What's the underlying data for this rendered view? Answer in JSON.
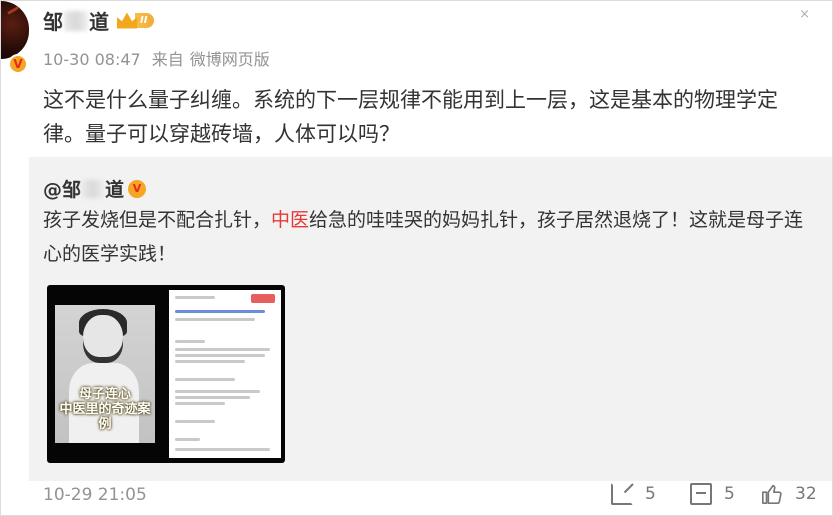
{
  "close_glyph": "×",
  "author": {
    "name_first": "邹",
    "name_last": "道",
    "level_badge": "II",
    "verified_glyph": "V"
  },
  "meta": {
    "date_time": "10-30 08:47",
    "source_prefix": "来自",
    "source": "微博网页版"
  },
  "post_text": "这不是什么量子纠缠。系统的下一层规律不能用到上一层，这是基本的物理学定律。量子可以穿越砖墙，人体可以吗？",
  "repost": {
    "author_prefix": "@邹",
    "author_suffix": "道",
    "verified_glyph": "V",
    "text_before": "孩子发烧但是不配合扎针，",
    "text_highlight": "中医",
    "text_after": "给急的哇哇哭的妈妈扎针，孩子居然退烧了！这就是母子连心的医学实践！",
    "video": {
      "caption_line1": "母子连心",
      "caption_line2": "中医里的奇迹案例"
    }
  },
  "footer": {
    "date_time": "10-29 21:05",
    "shares": "5",
    "comments": "5",
    "likes": "32"
  },
  "colors": {
    "highlight": "#e53935",
    "badge": "#f5a623",
    "muted": "#939393"
  }
}
